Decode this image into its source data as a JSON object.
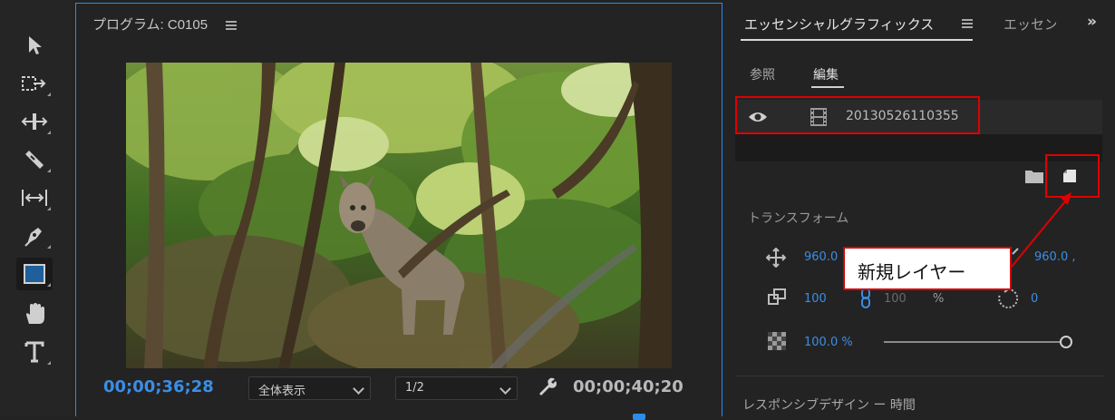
{
  "colors": {
    "accent": "#2d8ceb",
    "highlight_red": "#e00000",
    "timecode_blue": "#3a8ee6"
  },
  "toolbar": {
    "tools": [
      {
        "name": "selection-tool",
        "icon": "arrow-icon"
      },
      {
        "name": "track-select-tool",
        "icon": "track-select-icon"
      },
      {
        "name": "ripple-edit-tool",
        "icon": "ripple-edit-icon"
      },
      {
        "name": "razor-tool",
        "icon": "razor-icon"
      },
      {
        "name": "slip-tool",
        "icon": "slip-icon"
      },
      {
        "name": "pen-tool",
        "icon": "pen-icon"
      },
      {
        "name": "rectangle-tool",
        "icon": "rectangle-icon"
      },
      {
        "name": "hand-tool",
        "icon": "hand-icon"
      },
      {
        "name": "type-tool",
        "icon": "type-icon"
      }
    ]
  },
  "monitor": {
    "title": "プログラム: C0105",
    "timecode_current": "00;00;36;28",
    "zoom_select": "全体表示",
    "resolution_select": "1/2",
    "timecode_total": "00;00;40;20"
  },
  "graphics": {
    "tab_active": "エッセンシャルグラフィックス",
    "tab_other": "エッセン",
    "tab_more": "»",
    "subtab_browse": "参照",
    "subtab_edit": "編集",
    "layer_name": "20130526110355",
    "section_transform": "トランスフォーム",
    "position_x": "960.0",
    "anchor_x": "960.0 ,",
    "scale": "100",
    "scale_percent": "%",
    "scale_unlinked": "100",
    "rotation": "0",
    "opacity": "100.0 %",
    "section_responsive": "レスポンシブデザイン ー 時間"
  },
  "callout": {
    "text": "新規レイヤー"
  }
}
